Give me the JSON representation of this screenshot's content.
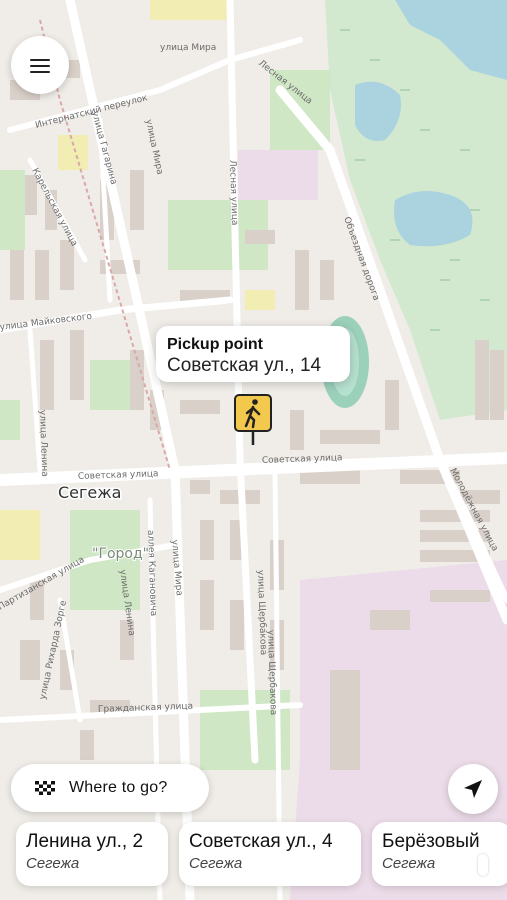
{
  "map": {
    "city_label": "Сегежа",
    "district_label": "\"Город\"",
    "streets": {
      "mira_top": "улица Мира",
      "lesnaya_top": "Лесная улица",
      "internatsionalny": "Интернатский переулок",
      "gagarina": "улица Гагарина",
      "mira_mid": "улица Мира",
      "lesnaya_mid": "Лесная улица",
      "karelskaya": "Карельская улица",
      "obyezdnaya": "Объездная дорога",
      "maikovskogo": "улица Майковского",
      "sovetskaya_w": "Советская улица",
      "sovetskaya_e": "Советская улица",
      "lenina_w": "улица Ленина",
      "molodezhnaya": "Молодёжная улица",
      "partizanskaya": "Партизанская улица",
      "rikharda_zorge": "улица Рихарда Зорге",
      "kaganovicha": "аллея Кагановича",
      "mira_low": "улица Мира",
      "lenina_low": "улица Ленина",
      "shcherbakova": "улица Щербакова",
      "shcherbakova2": "улица Щербакова",
      "grazhdanskaya": "Гражданская улица"
    }
  },
  "menu": {
    "icon": "hamburger-menu-icon"
  },
  "pickup": {
    "title": "Pickup point",
    "address": "Советская ул., 14",
    "pin_color": "#f2c94c",
    "pin_icon": "pedestrian-icon"
  },
  "where_to": {
    "label": "Where to go?",
    "icon": "checkered-flag-icon"
  },
  "locate": {
    "icon": "navigation-arrow-icon"
  },
  "suggestions": [
    {
      "title": "Ленина ул., 2",
      "city": "Сегежа"
    },
    {
      "title": "Советская ул., 4",
      "city": "Сегежа"
    },
    {
      "title": "Берёзовый",
      "city": "Сегежа"
    }
  ],
  "colors": {
    "water": "#aad3df",
    "park": "#c8e6c0",
    "wetland": "#d6ead3",
    "industrial": "#ebdbe8",
    "building": "#d9d0c9"
  }
}
